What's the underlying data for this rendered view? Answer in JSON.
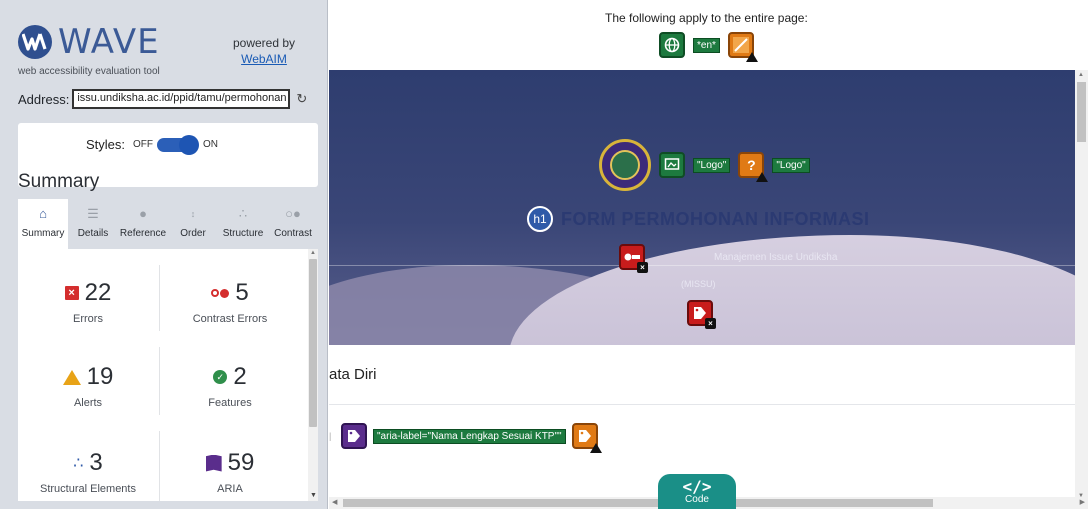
{
  "sidebar": {
    "logo_text": "WAVE",
    "logo_subtitle": "web accessibility evaluation tool",
    "powered_by": "powered by",
    "powered_link": "WebAIM",
    "address_label": "Address:",
    "address_value": "issu.undiksha.ac.id/ppid/tamu/permohonan",
    "styles_label": "Styles:",
    "styles_off": "OFF",
    "styles_on": "ON",
    "styles_state": "on",
    "summary_title": "Summary",
    "tabs": [
      {
        "label": "Summary",
        "icon": "home-icon",
        "active": true
      },
      {
        "label": "Details",
        "icon": "list-icon",
        "active": false
      },
      {
        "label": "Reference",
        "icon": "info-icon",
        "active": false
      },
      {
        "label": "Order",
        "icon": "order-icon",
        "active": false
      },
      {
        "label": "Structure",
        "icon": "structure-icon",
        "active": false
      },
      {
        "label": "Contrast",
        "icon": "contrast-icon",
        "active": false
      }
    ],
    "stats": {
      "errors": {
        "count": "22",
        "label": "Errors",
        "color": "#d42e2e"
      },
      "contrast_errors": {
        "count": "5",
        "label": "Contrast Errors",
        "color": "#d42e2e"
      },
      "alerts": {
        "count": "19",
        "label": "Alerts",
        "color": "#e8a317"
      },
      "features": {
        "count": "2",
        "label": "Features",
        "color": "#2f8f4b"
      },
      "structural": {
        "count": "3",
        "label": "Structural Elements",
        "color": "#2f5aa8"
      },
      "aria": {
        "count": "59",
        "label": "ARIA",
        "color": "#5a2d8c"
      }
    }
  },
  "main": {
    "page_note": "The following apply to the entire page:",
    "lang_tag": "*en*",
    "logo_alt_1": "\"Logo\"",
    "logo_alt_2": "\"Logo\"",
    "h1_badge": "h1",
    "h1_text": "FORM PERMOHONAN INFORMASI",
    "hero_sub1": "Manajemen Issue Undiksha",
    "hero_sub2": "(MISSU)",
    "section_title": "ata Diri",
    "aria_label_tag": "\"aria-label=\"Nama Lengkap Sesuai KTP\"\"",
    "code_button": "Code",
    "code_glyph": "</>"
  }
}
